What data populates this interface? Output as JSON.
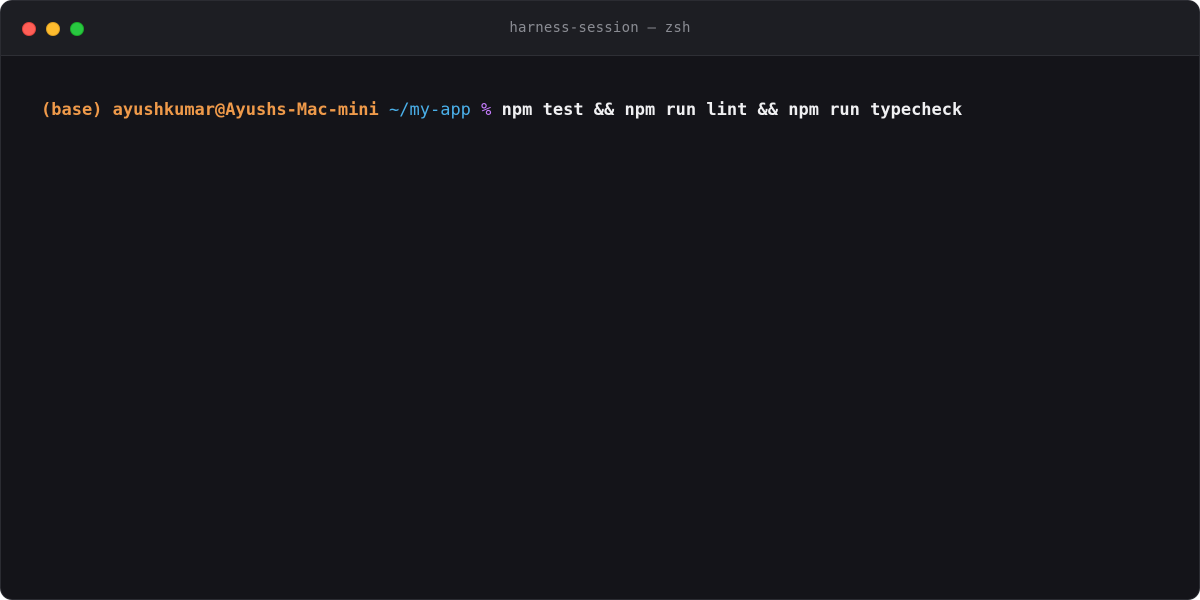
{
  "window": {
    "title": "harness-session — zsh",
    "colors": {
      "background": "#141419",
      "titlebar": "#1d1e23",
      "close": "#ff5f57",
      "minimize": "#febc2e",
      "maximize": "#28c840"
    }
  },
  "terminal": {
    "prompt": {
      "env": "(base)",
      "user_host": "ayushkumar@Ayushs-Mac-mini",
      "cwd": "~/my-app",
      "symbol": "%"
    },
    "command": "npm test && npm run lint && npm run typecheck",
    "colors": {
      "env": "#ef9a4a",
      "user_host": "#ef9a4a",
      "cwd": "#4ab0ea",
      "symbol": "#c77dff",
      "command": "#f0f0f2"
    }
  }
}
